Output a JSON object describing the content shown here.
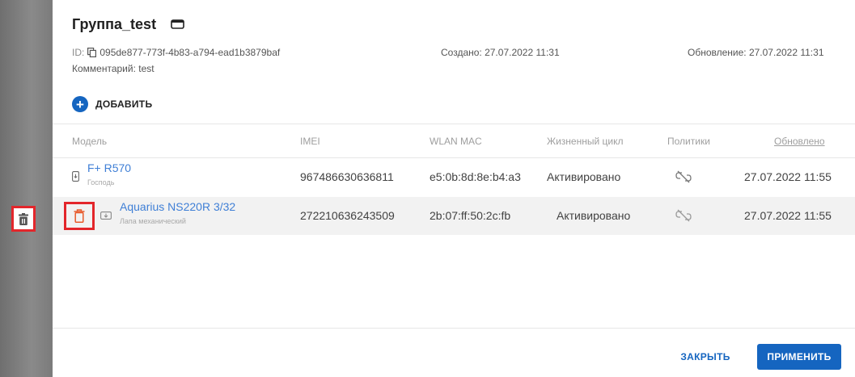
{
  "header": {
    "title": "Группа_test",
    "id_label": "ID:",
    "id_value": "095de877-773f-4b83-a794-ead1b3879baf",
    "comment": "Комментарий: test",
    "created": "Создано: 27.07.2022 11:31",
    "updated": "Обновление: 27.07.2022 11:31"
  },
  "actions": {
    "add_label": "ДОБАВИТЬ"
  },
  "table": {
    "columns": {
      "model": "Модель",
      "imei": "IMEI",
      "wlan": "WLAN MAC",
      "lifecycle": "Жизненный цикл",
      "policies": "Политики",
      "updated": "Обновлено"
    },
    "rows": [
      {
        "name": "F+ R570",
        "sub": "Господь",
        "imei": "967486630636811",
        "wlan": "e5:0b:8d:8e:b4:a3",
        "lifecycle": "Активировано",
        "policy_icon": "unlinked-icon",
        "updated": "27.07.2022 11:55"
      },
      {
        "name": "Aquarius NS220R 3/32",
        "sub": "Лапа механический",
        "imei": "272210636243509",
        "wlan": "2b:07:ff:50:2c:fb",
        "lifecycle": "Активировано",
        "policy_icon": "unlinked-icon",
        "updated": "27.07.2022 11:55"
      }
    ]
  },
  "footer": {
    "close_label": "ЗАКРЫТЬ",
    "apply_label": "ПРИМЕНИТЬ"
  },
  "colors": {
    "accent": "#1565c0",
    "link": "#3f7fd6",
    "highlight": "#e3262b",
    "delete_icon": "#e85a2a"
  }
}
